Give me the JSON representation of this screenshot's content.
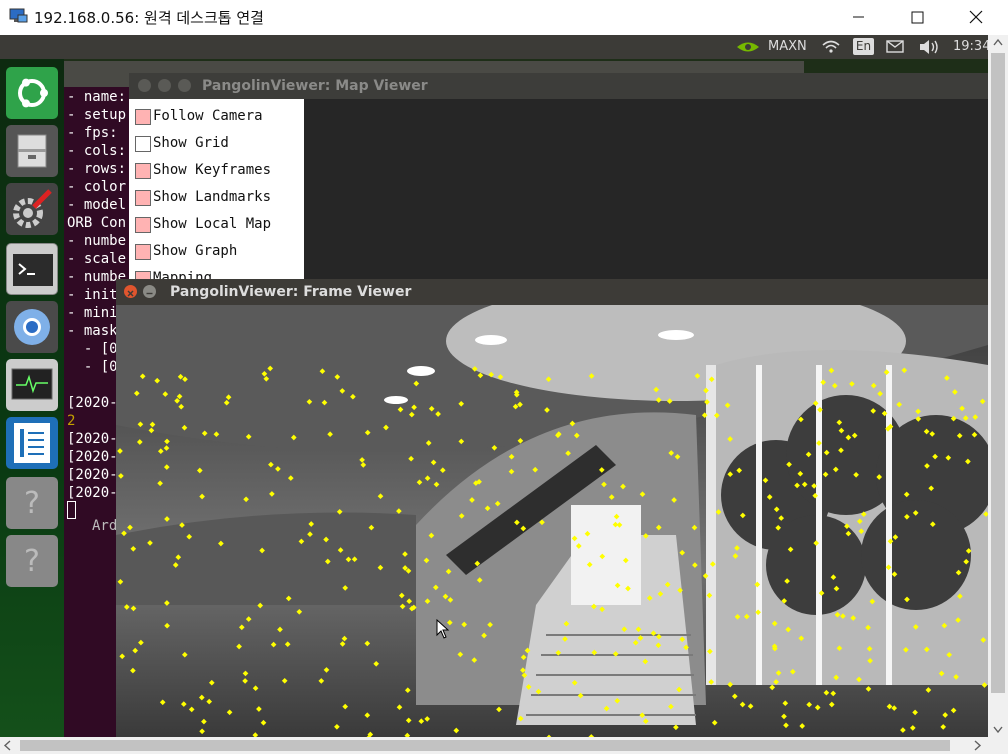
{
  "rdp": {
    "title": "192.168.0.56: 원격 데스크톱 연결",
    "minimize_label": "minimize",
    "maximize_label": "maximize",
    "close_label": "close"
  },
  "panel": {
    "gpu_mode": "MAXN",
    "keyboard": "En",
    "clock": "19:34"
  },
  "launcher": {
    "items": [
      "ubuntu-home",
      "files",
      "system-settings",
      "terminal",
      "chromium",
      "system-monitor",
      "text-editor",
      "unknown-app-1",
      "unknown-app-2"
    ]
  },
  "terminal": {
    "lines": [
      "- name:",
      "- setup",
      "- fps:",
      "- cols:",
      "- rows:",
      "- color",
      "- model",
      "ORB Con",
      "- numbe",
      "- scale",
      "- numbe",
      "- init",
      "- mini",
      "- mask",
      "  - [0",
      "  - [0",
      "",
      "[2020-",
      "2",
      "[2020-",
      "[2020-",
      "[2020-",
      "[2020-"
    ],
    "prompt_fragment": "Ard"
  },
  "map_viewer": {
    "title": "PangolinViewer: Map Viewer",
    "options": [
      {
        "label": "Follow Camera",
        "checked": true
      },
      {
        "label": "Show Grid",
        "checked": false
      },
      {
        "label": "Show Keyframes",
        "checked": true
      },
      {
        "label": "Show Landmarks",
        "checked": true
      },
      {
        "label": "Show Local Map",
        "checked": true
      },
      {
        "label": "Show Graph",
        "checked": true
      },
      {
        "label": "Mapping",
        "checked": true
      }
    ]
  },
  "frame_viewer": {
    "title": "PangolinViewer: Frame Viewer"
  },
  "colors": {
    "checkbox_on": "#ffb3b3",
    "feature_point": "#ffff00",
    "terminal_bg": "#300a24"
  }
}
